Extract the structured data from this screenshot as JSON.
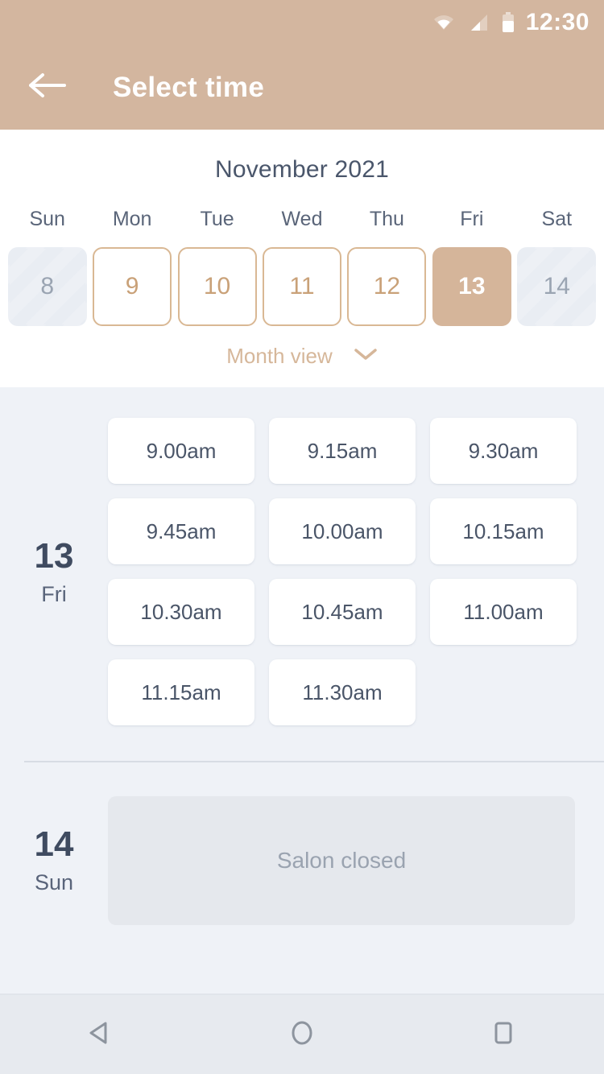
{
  "statusbar": {
    "time": "12:30",
    "icons": [
      "wifi-icon",
      "signal-icon",
      "battery-icon"
    ]
  },
  "appbar": {
    "back_icon": "back-arrow-icon",
    "title": "Select time"
  },
  "calendar": {
    "month_title": "November 2021",
    "weekdays": [
      "Sun",
      "Mon",
      "Tue",
      "Wed",
      "Thu",
      "Fri",
      "Sat"
    ],
    "days": [
      {
        "num": "8",
        "state": "disabled"
      },
      {
        "num": "9",
        "state": "enabled"
      },
      {
        "num": "10",
        "state": "enabled"
      },
      {
        "num": "11",
        "state": "enabled"
      },
      {
        "num": "12",
        "state": "enabled"
      },
      {
        "num": "13",
        "state": "selected"
      },
      {
        "num": "14",
        "state": "disabled"
      }
    ],
    "month_view_label": "Month view",
    "month_view_icon": "chevron-down-icon"
  },
  "day_sections": [
    {
      "day_num": "13",
      "day_dow": "Fri",
      "slots": [
        "9.00am",
        "9.15am",
        "9.30am",
        "9.45am",
        "10.00am",
        "10.15am",
        "10.30am",
        "10.45am",
        "11.00am",
        "11.15am",
        "11.30am"
      ]
    },
    {
      "day_num": "14",
      "day_dow": "Sun",
      "closed_label": "Salon closed"
    }
  ],
  "navbar": {
    "back_label": "back-triangle-icon",
    "home_label": "home-circle-icon",
    "recents_label": "recents-square-icon"
  },
  "colors": {
    "accent": "#d3b69f",
    "selected_day": "#d5b59a",
    "day_border": "#d9b894",
    "day_text": "#c9a178",
    "page_bg": "#eff2f7",
    "panel_bg": "#ffffff",
    "text_dark": "#3f4b60",
    "text_muted": "#9aa3b0",
    "closed_card": "#e5e8ed"
  }
}
